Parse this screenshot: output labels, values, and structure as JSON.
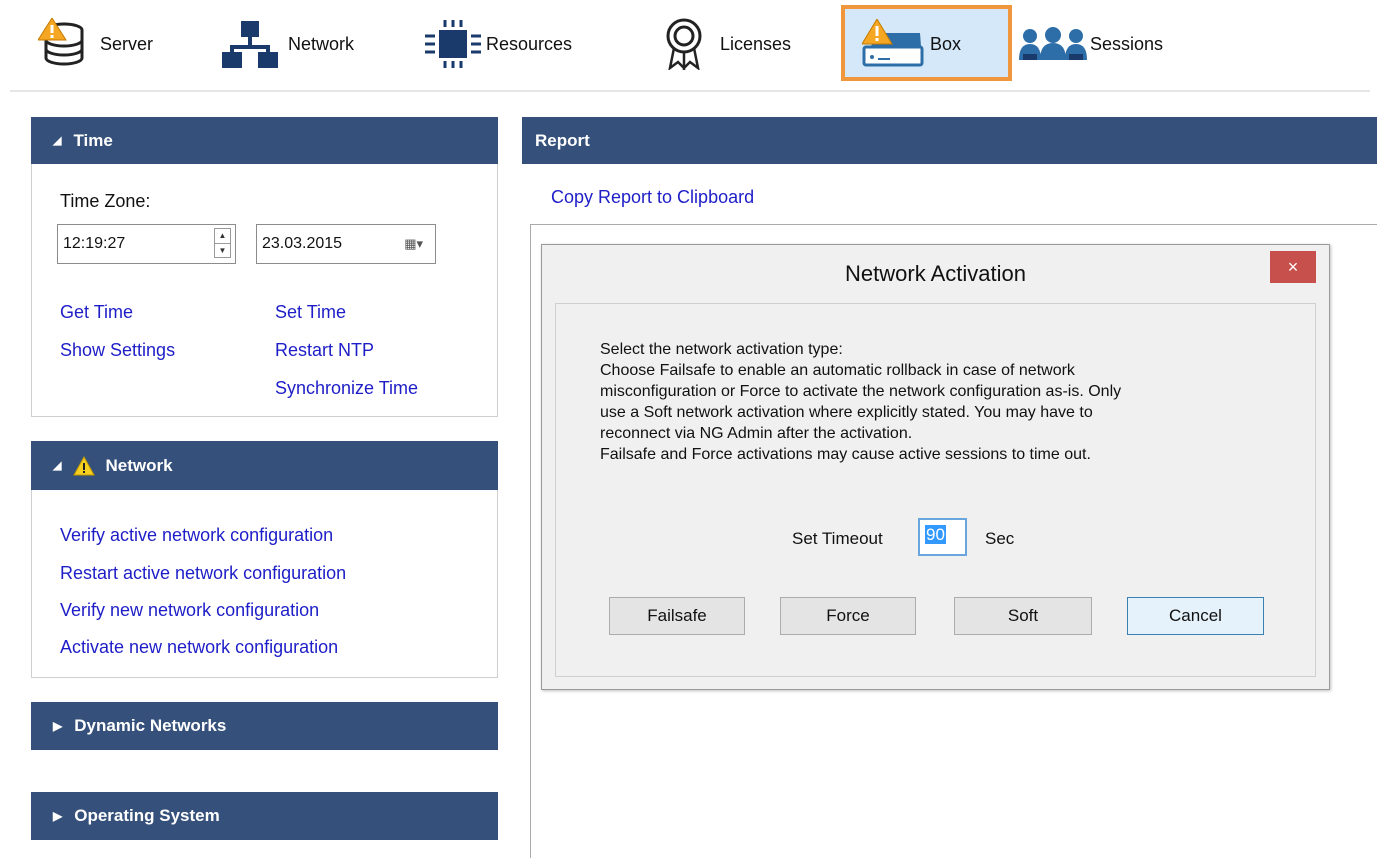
{
  "toolbar": {
    "items": [
      {
        "label": "Server",
        "icon": "server-warning-icon"
      },
      {
        "label": "Network",
        "icon": "network-icon"
      },
      {
        "label": "Resources",
        "icon": "chip-icon"
      },
      {
        "label": "Licenses",
        "icon": "license-badge-icon"
      },
      {
        "label": "Box",
        "icon": "box-warning-icon",
        "selected": true
      },
      {
        "label": "Sessions",
        "icon": "users-icon"
      }
    ]
  },
  "time_panel": {
    "title": "Time",
    "timezone_label": "Time Zone:",
    "time_value": "12:19:27",
    "date_value": "23.03.2015",
    "links": {
      "get_time": "Get Time",
      "set_time": "Set Time",
      "show_settings": "Show Settings",
      "restart_ntp": "Restart NTP",
      "synchronize_time": "Synchronize Time"
    }
  },
  "network_panel": {
    "title": "Network",
    "links": [
      "Verify active network configuration",
      "Restart active network configuration",
      "Verify new network configuration",
      "Activate new network configuration"
    ]
  },
  "dynamic_networks_panel": {
    "title": "Dynamic Networks"
  },
  "operating_system_panel": {
    "title": "Operating System"
  },
  "report": {
    "title": "Report",
    "copy_link": "Copy Report to Clipboard"
  },
  "dialog": {
    "title": "Network Activation",
    "close_glyph": "×",
    "message_lines": [
      "Select the network activation type:",
      "Choose Failsafe to enable an automatic rollback in case of network",
      "misconfiguration or Force to activate the network configuration as-is. Only",
      "use a Soft network activation where explicitly stated. You may have to",
      "reconnect via NG Admin after the activation.",
      "Failsafe and Force activations may cause active sessions to time out."
    ],
    "timeout_label": "Set Timeout",
    "timeout_value": "90",
    "timeout_unit": "Sec",
    "buttons": {
      "failsafe": "Failsafe",
      "force": "Force",
      "soft": "Soft",
      "cancel": "Cancel"
    }
  },
  "colors": {
    "panel_header": "#35507a",
    "link": "#1e1ec8",
    "selected_tab_border": "#f0963c",
    "selected_tab_bg": "#d5e8f9",
    "warning": "#f5a623",
    "close_button": "#c7504c"
  }
}
